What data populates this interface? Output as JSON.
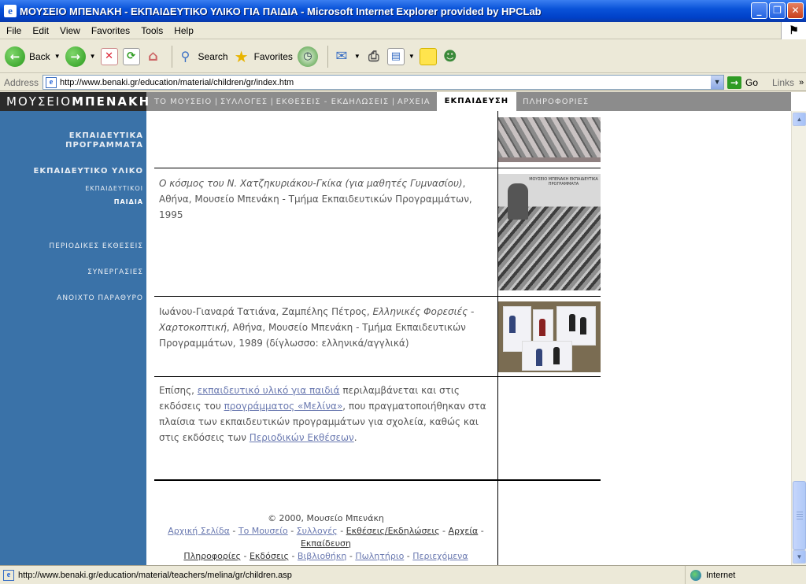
{
  "window": {
    "title": "ΜΟΥΣΕΙΟ ΜΠΕΝΑΚΗ - ΕΚΠΑΙΔΕΥΤΙΚΟ ΥΛΙΚΟ ΓΙΑ ΠΑΙΔΙΑ - Microsoft Internet Explorer provided by HPCLab",
    "controls": [
      "_",
      "❐",
      "✕"
    ]
  },
  "menu": [
    "File",
    "Edit",
    "View",
    "Favorites",
    "Tools",
    "Help"
  ],
  "toolbar": {
    "back_label": "Back",
    "search_label": "Search",
    "favorites_label": "Favorites"
  },
  "address": {
    "label": "Address",
    "url": "http://www.benaki.gr/education/material/children/gr/index.htm",
    "go_label": "Go",
    "links_label": "Links"
  },
  "site_nav": {
    "logo_part1": "ΜΟΥΣΕΙΟ",
    "logo_part2": "ΜΠΕΝΑΚΗ",
    "items": [
      "ΤΟ ΜΟΥΣΕΙΟ",
      "ΣΥΛΛΟΓΕΣ",
      "ΕΚΘΕΣΕΙΣ - ΕΚΔΗΛΩΣΕΙΣ",
      "ΑΡΧΕΙΑ"
    ],
    "active": "ΕΚΠΑΙΔΕΥΣΗ",
    "last": "ΠΛΗΡΟΦΟΡΙΕΣ",
    "separator": "|"
  },
  "sidebar": {
    "programs_line1": "ΕΚΠΑΙΔΕΥΤΙΚΑ",
    "programs_line2": "ΠΡΟΓΡΑΜΜΑΤΑ",
    "material": "ΕΚΠΑΙΔΕΥΤΙΚΟ ΥΛΙΚΟ",
    "teachers": "ΕΚΠΑΙΔΕΥΤΙΚΟΙ",
    "children": "ΠΑΙΔΙΑ",
    "periodic": "ΠΕΡΙΟΔΙΚΕΣ ΕΚΘΕΣΕΙΣ",
    "collaborations": "ΣΥΝΕΡΓΑΣΙΕΣ",
    "open_window": "ΑΝΟΙΧΤΟ ΠΑΡΑΘΥΡΟ"
  },
  "entries": {
    "e1_title": "Ο κόσμος του Ν. Χατζηκυριάκου-Γκίκα (για μαθητές Γυμνασίου)",
    "e1_rest": ", Αθήνα, Μουσείο Μπενάκη - Τμήμα Εκπαιδευτικών Προγραμμάτων, 1995",
    "e2_authors": "Ιωάνου-Γιαναρά Τατιάνα, Ζαμπέλης Πέτρος, ",
    "e2_title": "Ελληνικές Φορεσιές - Χαρτοκοπτική",
    "e2_rest": ", Αθήνα, Μουσείο Μπενάκη - Τμήμα Εκπαιδευτικών Προγραμμάτων, 1989 (δίγλωσσο: ελληνικά/αγγλικά)",
    "thumb2_caption": "ΜΟΥΣΕΙΟ ΜΠΕΝΑΚΗ ΕΚΠΑΙΔΕΥΤΙΚΑ ΠΡΟΓΡΑΜΜΑΤΑ"
  },
  "note": {
    "t1": "Επίσης, ",
    "link1": "εκπαιδευτικό υλικό για παιδιά",
    "t2": " περιλαμβάνεται και στις εκδόσεις του ",
    "link2": "προγράμματος «Μελίνα»",
    "t3": ", που πραγματοποιήθηκαν στα πλαίσια των εκπαιδευτικών προγραμμάτων για σχολεία, καθώς και στις εκδόσεις των ",
    "link3": "Περιοδικών Εκθέσεων",
    "t4": "."
  },
  "footer": {
    "copyright": "© 2000, Μουσείο Μπενάκη",
    "row1": [
      "Αρχική Σελίδα",
      "Το Μουσείο",
      "Συλλογές",
      "Εκθέσεις/Εκδηλώσεις",
      "Αρχεία",
      "Εκπαίδευση"
    ],
    "row2": [
      "Πληροφορίες",
      "Εκδόσεις",
      "Βιβλιοθήκη",
      "Πωλητήριο",
      "Περιεχόμενα"
    ],
    "sep": " - "
  },
  "status": {
    "url": "http://www.benaki.gr/education/material/teachers/melina/gr/children.asp",
    "zone": "Internet"
  }
}
